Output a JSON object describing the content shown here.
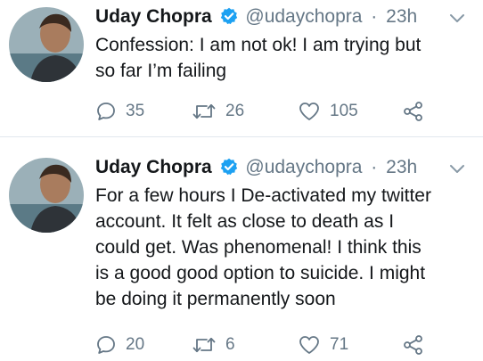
{
  "tweets": [
    {
      "display_name": "Uday Chopra",
      "handle": "@udaychopra",
      "time": "23h",
      "lines": [
        "Confession: I am not ok! I am trying but",
        "so far I’m failing"
      ],
      "replies": "35",
      "retweets": "26",
      "likes": "105"
    },
    {
      "display_name": "Uday Chopra",
      "handle": "@udaychopra",
      "time": "23h",
      "lines": [
        "For a few hours I De-activated my twitter",
        "account. It felt as close to death as I",
        "could get. Was phenomenal! I think this",
        "is a good good option to suicide. I might",
        "be doing it permanently soon"
      ],
      "replies": "20",
      "retweets": "6",
      "likes": "71"
    }
  ],
  "separator": "·",
  "colors": {
    "verified_badge": "#1da1f2",
    "secondary_text": "#657786",
    "primary_text": "#14171a",
    "divider": "#e1e8ed"
  },
  "icons": {
    "reply": "reply-icon",
    "retweet": "retweet-icon",
    "like": "heart-icon",
    "share": "share-icon",
    "menu": "chevron-down-icon",
    "verified": "verified-badge-icon"
  }
}
